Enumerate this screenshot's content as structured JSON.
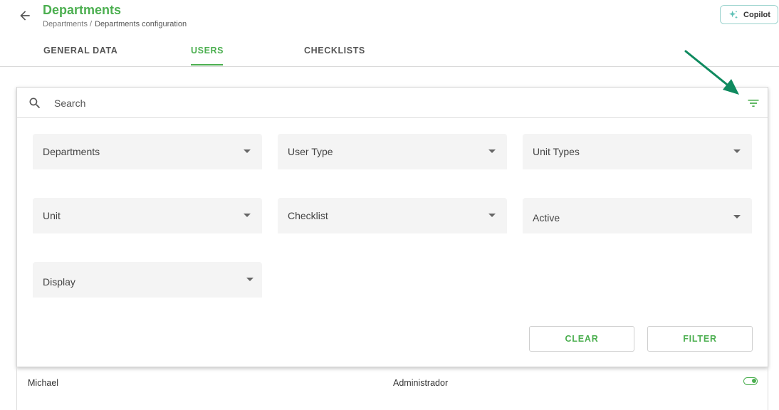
{
  "header": {
    "title": "Departments",
    "breadcrumb": [
      "Departments /",
      "Departments configuration"
    ],
    "copilot_label": "Copilot"
  },
  "tabs": [
    {
      "label": "GENERAL DATA",
      "active": false
    },
    {
      "label": "USERS",
      "active": true
    },
    {
      "label": "CHECKLISTS",
      "active": false
    }
  ],
  "search": {
    "placeholder": "Search",
    "value": ""
  },
  "filters": [
    {
      "label": "Departments"
    },
    {
      "label": "User Type"
    },
    {
      "label": "Unit Types"
    },
    {
      "label": "Unit"
    },
    {
      "label": "Checklist"
    },
    {
      "label": "Active"
    },
    {
      "label": "Display"
    }
  ],
  "actions": {
    "clear_label": "CLEAR",
    "filter_label": "FILTER"
  },
  "table": {
    "rows": [
      {
        "name": "Michael",
        "role": "Administrador",
        "active": true
      }
    ]
  },
  "colors": {
    "accent": "#4caf50",
    "annotation_arrow": "#0f8a5f",
    "copilot_border": "#9bd3ce"
  },
  "icons": [
    "arrow-left-icon",
    "sparkle-icon",
    "search-icon",
    "filter-list-icon",
    "caret-down-icon",
    "toggle-on-icon"
  ]
}
